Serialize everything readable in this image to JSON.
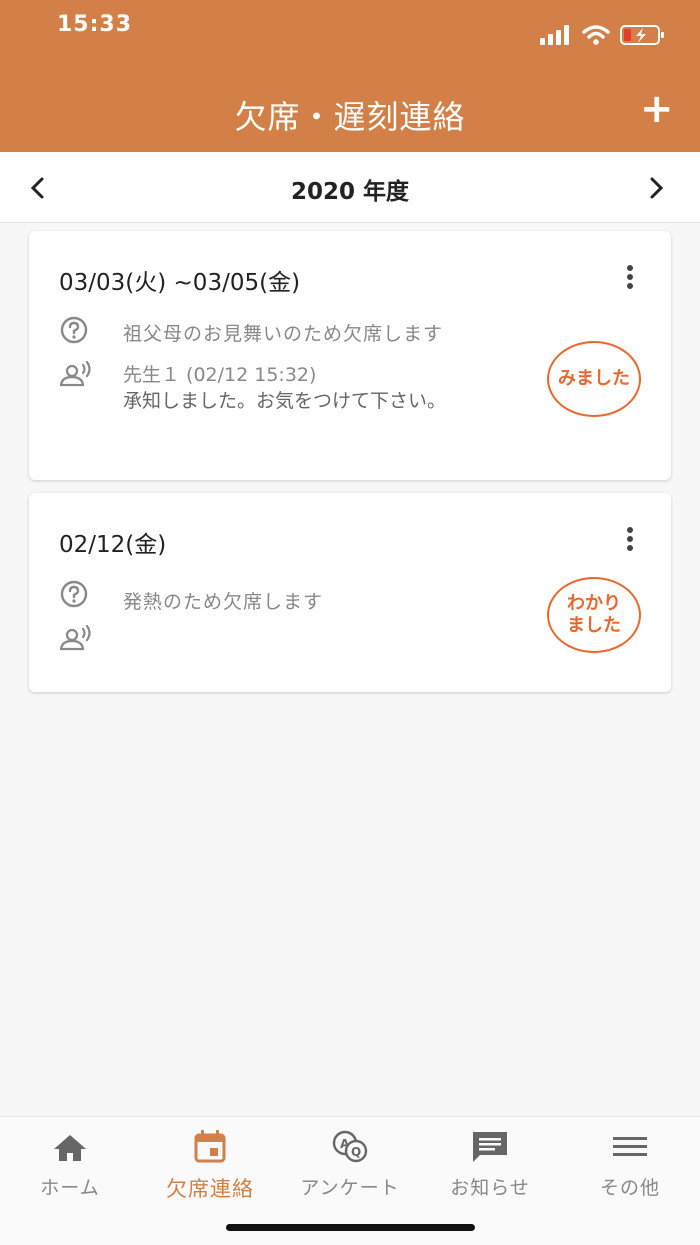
{
  "status_bar": {
    "time": "15:33"
  },
  "header": {
    "title": "欠席・遅刻連絡",
    "add_label": "+"
  },
  "year_bar": {
    "label": "2020 年度"
  },
  "colors": {
    "brand": "#d28047",
    "stamp": "#e8682e"
  },
  "cards": [
    {
      "date": "03/03(火) ~03/05(金)",
      "reason": "祖父母のお見舞いのため欠席します",
      "reply_meta": "先生１ (02/12 15:32)",
      "reply_text": "承知しました。お気をつけて下さい。",
      "stamp": "みました"
    },
    {
      "date": "02/12(金)",
      "reason": "発熱のため欠席します",
      "stamp_line1": "わかり",
      "stamp_line2": "ました"
    }
  ],
  "nav": [
    {
      "label": "ホーム",
      "icon": "home-icon"
    },
    {
      "label": "欠席連絡",
      "icon": "calendar-icon"
    },
    {
      "label": "アンケート",
      "icon": "survey-icon"
    },
    {
      "label": "お知らせ",
      "icon": "message-icon"
    },
    {
      "label": "その他",
      "icon": "menu-icon"
    }
  ]
}
